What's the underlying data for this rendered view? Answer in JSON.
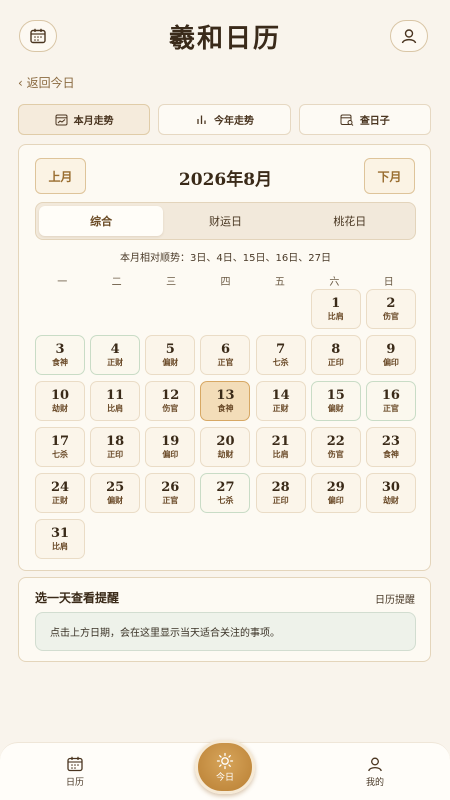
{
  "app": {
    "title": "羲和日历"
  },
  "header": {
    "calendar_icon": "calendar-icon",
    "profile_icon": "user-icon"
  },
  "back": {
    "label": "‹ 返回今日"
  },
  "top_tabs": [
    {
      "label": "本月走势",
      "icon": "calendar-trend-icon"
    },
    {
      "label": "今年走势",
      "icon": "bar-chart-icon"
    },
    {
      "label": "查日子",
      "icon": "calendar-search-icon"
    }
  ],
  "calendar": {
    "prev_label": "上月",
    "next_label": "下月",
    "month_title": "2026年8月",
    "filters": [
      "综合",
      "财运日",
      "桃花日"
    ],
    "luck_line": "本月相对顺势：3日、4日、15日、16日、27日",
    "weekdays": [
      "一",
      "二",
      "三",
      "四",
      "五",
      "六",
      "日"
    ],
    "days": [
      {
        "num": "1",
        "tag": "比肩"
      },
      {
        "num": "2",
        "tag": "伤官"
      },
      {
        "num": "3",
        "tag": "食神"
      },
      {
        "num": "4",
        "tag": "正财"
      },
      {
        "num": "5",
        "tag": "偏财"
      },
      {
        "num": "6",
        "tag": "正官"
      },
      {
        "num": "7",
        "tag": "七杀"
      },
      {
        "num": "8",
        "tag": "正印"
      },
      {
        "num": "9",
        "tag": "偏印"
      },
      {
        "num": "10",
        "tag": "劫财"
      },
      {
        "num": "11",
        "tag": "比肩"
      },
      {
        "num": "12",
        "tag": "伤官"
      },
      {
        "num": "13",
        "tag": "食神"
      },
      {
        "num": "14",
        "tag": "正财"
      },
      {
        "num": "15",
        "tag": "偏财"
      },
      {
        "num": "16",
        "tag": "正官"
      },
      {
        "num": "17",
        "tag": "七杀"
      },
      {
        "num": "18",
        "tag": "正印"
      },
      {
        "num": "19",
        "tag": "偏印"
      },
      {
        "num": "20",
        "tag": "劫财"
      },
      {
        "num": "21",
        "tag": "比肩"
      },
      {
        "num": "22",
        "tag": "伤官"
      },
      {
        "num": "23",
        "tag": "食神"
      },
      {
        "num": "24",
        "tag": "正财"
      },
      {
        "num": "25",
        "tag": "偏财"
      },
      {
        "num": "26",
        "tag": "正官"
      },
      {
        "num": "27",
        "tag": "七杀"
      },
      {
        "num": "28",
        "tag": "正印"
      },
      {
        "num": "29",
        "tag": "偏印"
      },
      {
        "num": "30",
        "tag": "劫财"
      },
      {
        "num": "31",
        "tag": "比肩"
      }
    ]
  },
  "tips": {
    "title": "选一天查看提醒",
    "link": "日历提醒",
    "body": "点击上方日期，会在这里显示当天适合关注的事项。"
  },
  "nav": {
    "calendar_label": "日历",
    "today_label": "今日",
    "me_label": "我的"
  },
  "colors": {
    "accent": "#c08a3e",
    "background": "#f9f4ec",
    "good_border": "#c9dcc6",
    "today_fill": "#f3ddb9"
  }
}
